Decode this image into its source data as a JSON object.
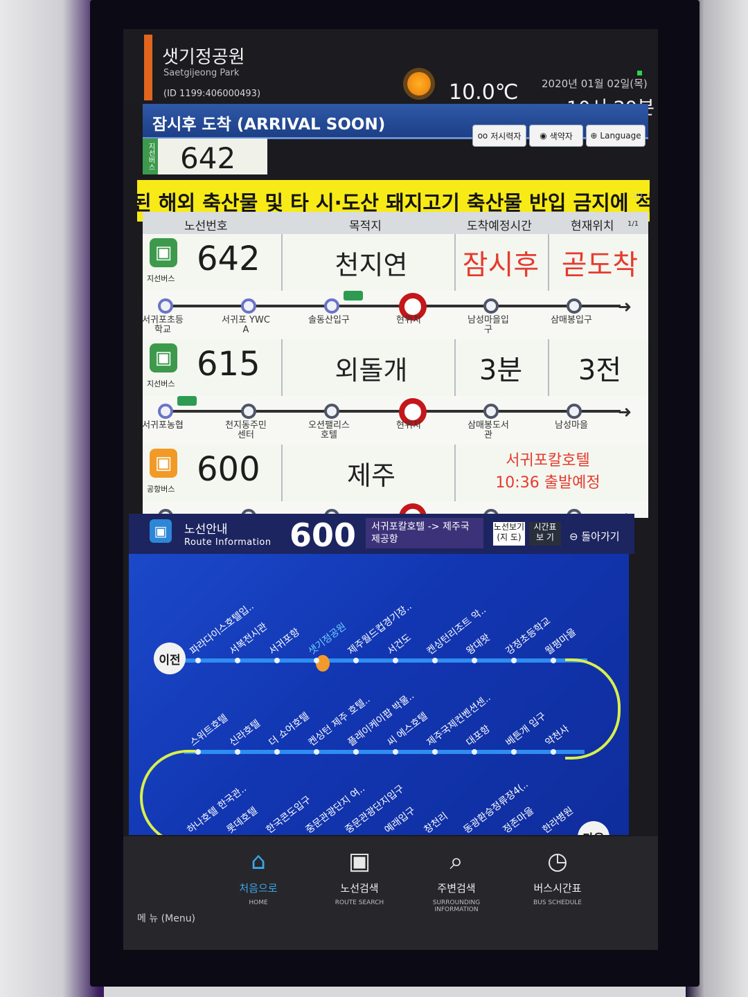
{
  "header": {
    "stop_name": "샛기정공원",
    "stop_name_en": "Saetgijeong Park",
    "stop_id": "(ID 1199:406000493)",
    "temperature": "10.0℃",
    "weather_icon": "sun-icon",
    "date": "2020년 01월 02일(목)",
    "time": "10시 29분"
  },
  "soon": {
    "title": "잠시후 도착 (ARRIVAL SOON)",
    "bus_type": "지선버스",
    "route": "642",
    "buttons": [
      "저시력자",
      "색약자",
      "Language"
    ]
  },
  "ticker": {
    "text": "된 해외 축산물 및 타 시·도산 돼지고기 축산물 반입 금지에 적",
    "page": "1/1"
  },
  "table": {
    "headers": [
      "노선번호",
      "목적지",
      "도착예정시간",
      "현재위치"
    ],
    "page": "1/1",
    "routes": [
      {
        "type": "지선버스",
        "number": "642",
        "destination": "천지연",
        "eta": "잠시후",
        "position": "곧도착",
        "stops": [
          "서귀포초등\n학교",
          "서귀포 YWC\nA",
          "솔동산입구",
          "현위치",
          "남성마을입\n구",
          "삼매봉입구"
        ]
      },
      {
        "type": "지선버스",
        "number": "615",
        "destination": "외돌개",
        "eta": "3분",
        "position": "3전",
        "stops": [
          "서귀포농협",
          "천지동주민\n센터",
          "오션팰리스\n호텔",
          "현위치",
          "삼매봉도서\n관",
          "남성마을"
        ]
      },
      {
        "type": "공항버스",
        "number": "600",
        "destination": "제주",
        "eta_line1": "서귀포칼호텔",
        "eta_line2": "10:36 출발예정"
      }
    ]
  },
  "route_info": {
    "title": "노선안내",
    "subtitle": "Route Information",
    "number": "600",
    "direction": "서귀포칼호텔 -> 제주국제공항",
    "btn_map": "노선보기 (지 도)",
    "btn_schedule": "시간표 보 기",
    "back": "돌아가기",
    "prev": "이전",
    "next": "다음",
    "row1": [
      "파라다이스호텔입..",
      "서복전시관",
      "서귀포항",
      "샛기정공원",
      "제주월드컵경기장..",
      "서건도",
      "켄싱턴리조트 악..",
      "왕대왓",
      "강정초등학교",
      "월평마을"
    ],
    "row2": [
      "스위트호텔",
      "신라호텔",
      "더 쇼어호텔",
      "켄싱턴 제주 호텔..",
      "플레이케이팝 박물..",
      "씨 에스호텔",
      "제주국제컨벤션센..",
      "대포항",
      "베튼개 입구",
      "약천사"
    ],
    "row3": [
      "하나호텔 한국관..",
      "롯데호텔",
      "한국콘도입구",
      "중문관광단지 여..",
      "중문관광단지입구",
      "예래입구",
      "창천리",
      "동광환승정류장4(..",
      "정존마을",
      "한라병원"
    ]
  },
  "nav": {
    "menu": "메 뉴 (Menu)",
    "items": [
      {
        "ko": "처음으로",
        "en": "HOME",
        "icon": "home-icon"
      },
      {
        "ko": "노선검색",
        "en": "ROUTE SEARCH",
        "icon": "bus-icon"
      },
      {
        "ko": "주변검색",
        "en": "SURROUNDING INFORMATION",
        "icon": "search-icon"
      },
      {
        "ko": "버스시간표",
        "en": "BUS SCHEDULE",
        "icon": "clock-icon"
      }
    ]
  },
  "colors": {
    "accent_blue": "#1d3f86",
    "ticker_yellow": "#f7ea17",
    "eta_red": "#e53b2f",
    "branch_green": "#3d9a4c",
    "airport_orange": "#f19a28",
    "map_blue": "#1236b2"
  }
}
